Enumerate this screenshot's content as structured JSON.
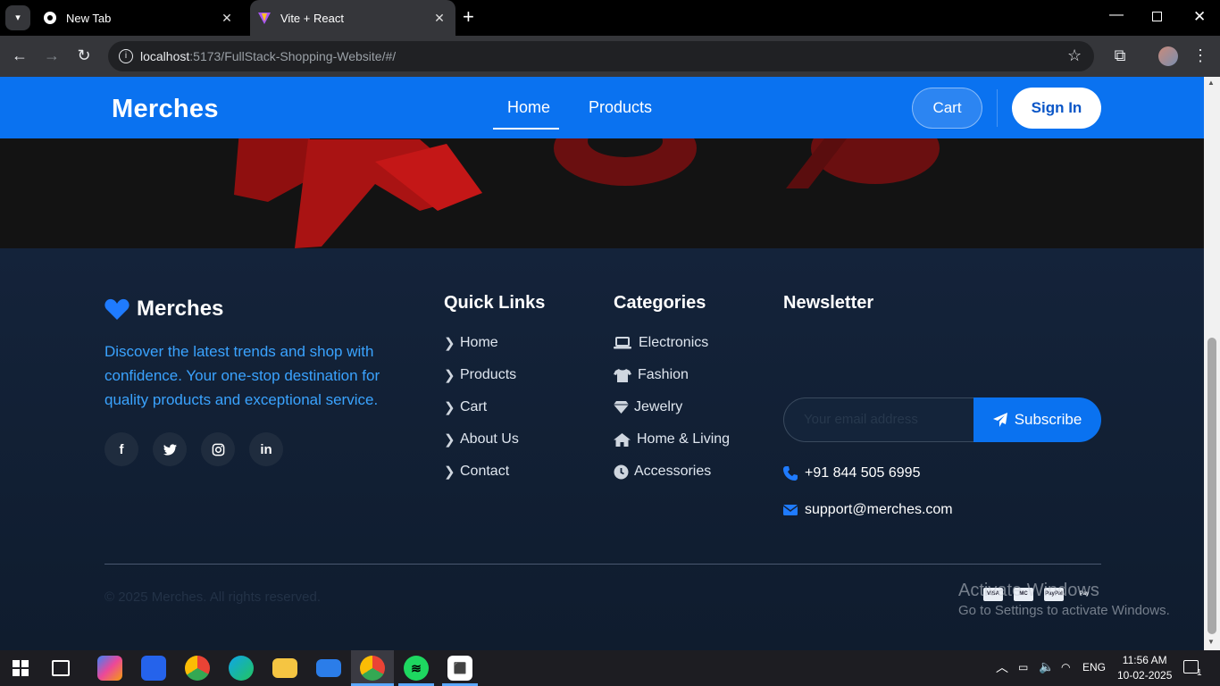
{
  "browser": {
    "tabs": [
      {
        "title": "New Tab",
        "active": false
      },
      {
        "title": "Vite + React",
        "active": true
      }
    ],
    "url_host": "localhost",
    "url_rest": ":5173/FullStack-Shopping-Website/#/"
  },
  "navbar": {
    "brand": "Merches",
    "links": [
      "Home",
      "Products"
    ],
    "active_link": "Home",
    "cart_label": "Cart",
    "signin_label": "Sign In"
  },
  "footer": {
    "brand": "Merches",
    "description": "Discover the latest trends and shop with confidence. Your one-stop destination for quality products and exceptional service.",
    "social": [
      "facebook-icon",
      "twitter-icon",
      "instagram-icon",
      "linkedin-icon"
    ],
    "quick_links": {
      "title": "Quick Links",
      "items": [
        "Home",
        "Products",
        "Cart",
        "About Us",
        "Contact"
      ]
    },
    "categories": {
      "title": "Categories",
      "items": [
        {
          "label": "Electronics",
          "icon": "laptop-icon"
        },
        {
          "label": "Fashion",
          "icon": "tshirt-icon"
        },
        {
          "label": "Jewelry",
          "icon": "gem-icon"
        },
        {
          "label": "Home & Living",
          "icon": "house-icon"
        },
        {
          "label": "Accessories",
          "icon": "clock-icon"
        }
      ]
    },
    "newsletter": {
      "title": "Newsletter",
      "placeholder": "Your email address",
      "button": "Subscribe",
      "phone": "+91 844 505 6995",
      "email": "support@merches.com"
    },
    "copyright": "© 2025 Merches. All rights reserved.",
    "payments": [
      "VISA",
      "MC",
      "PayPal",
      "Pay"
    ]
  },
  "watermark": {
    "line1": "Activate Windows",
    "line2": "Go to Settings to activate Windows."
  },
  "taskbar": {
    "language": "ENG",
    "time": "11:56 AM",
    "date": "10-02-2025",
    "notifications": "1"
  },
  "colors": {
    "primary": "#0a72f0",
    "footer_bg": "#0f1c2e",
    "accent_text": "#3aa3ff"
  }
}
